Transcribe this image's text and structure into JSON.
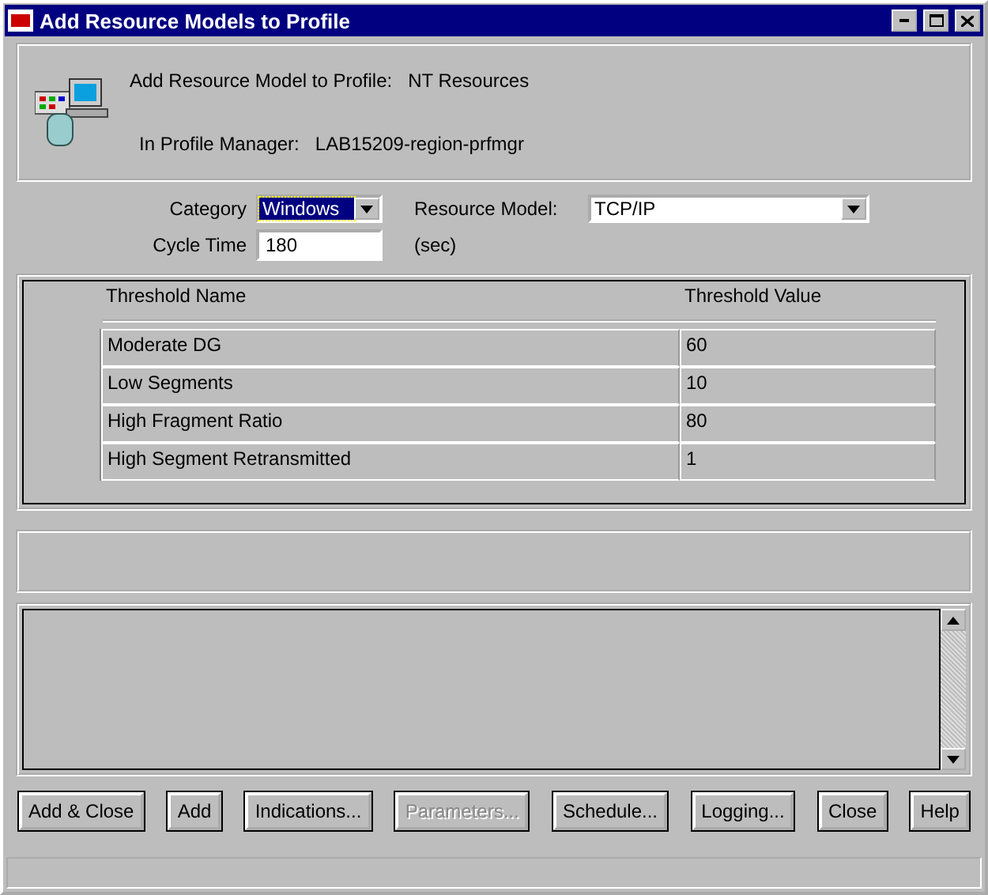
{
  "window": {
    "title": "Add Resource Models to Profile"
  },
  "header": {
    "profile_label": "Add Resource Model to Profile:",
    "profile_value": "NT Resources",
    "manager_label": "In Profile Manager:",
    "manager_value": "LAB15209-region-prfmgr"
  },
  "form": {
    "category_label": "Category",
    "category_value": "Windows",
    "model_label": "Resource Model:",
    "model_value": "TCP/IP",
    "cycle_label": "Cycle Time",
    "cycle_value": "180",
    "cycle_unit": "(sec)"
  },
  "table": {
    "columns": [
      "Threshold Name",
      "Threshold Value"
    ],
    "rows": [
      [
        "Moderate DG",
        "60"
      ],
      [
        "Low Segments",
        "10"
      ],
      [
        "High Fragment Ratio",
        "80"
      ],
      [
        "High Segment Retransmitted",
        "1"
      ]
    ]
  },
  "buttons": [
    {
      "label": "Add & Close",
      "disabled": false
    },
    {
      "label": "Add",
      "disabled": false
    },
    {
      "label": "Indications...",
      "disabled": false
    },
    {
      "label": "Parameters...",
      "disabled": true
    },
    {
      "label": "Schedule...",
      "disabled": false
    },
    {
      "label": "Logging...",
      "disabled": false
    },
    {
      "label": "Close",
      "disabled": false
    },
    {
      "label": "Help",
      "disabled": false
    }
  ]
}
